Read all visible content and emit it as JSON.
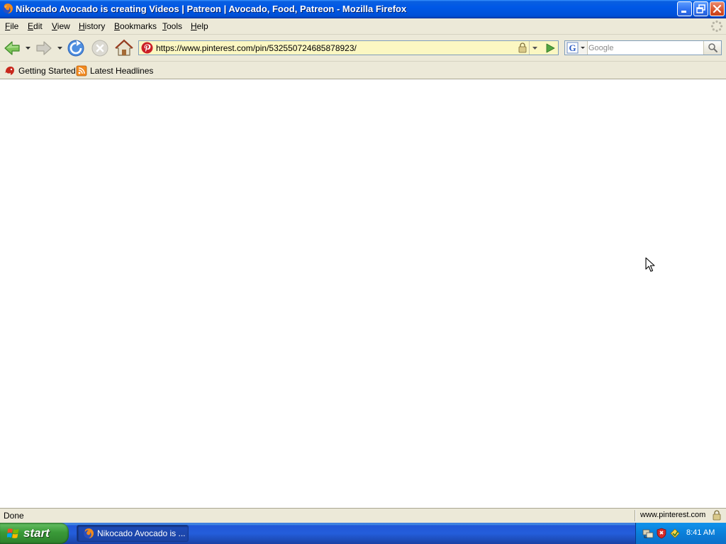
{
  "window": {
    "title": "Nikocado Avocado is creating Videos | Patreon | Avocado, Food, Patreon - Mozilla Firefox",
    "app_icon": "firefox-icon",
    "controls": [
      "minimize-icon",
      "restore-icon",
      "close-icon"
    ]
  },
  "menubar": {
    "items": [
      {
        "label": "File",
        "access": "F",
        "rest": "ile"
      },
      {
        "label": "Edit",
        "access": "E",
        "rest": "dit"
      },
      {
        "label": "View",
        "access": "V",
        "rest": "iew"
      },
      {
        "label": "History",
        "access": "H",
        "rest": "istory"
      },
      {
        "label": "Bookmarks",
        "access": "B",
        "rest": "ookmarks"
      },
      {
        "label": "Tools",
        "access": "T",
        "rest": "ools"
      },
      {
        "label": "Help",
        "access": "H",
        "rest": "elp"
      }
    ]
  },
  "navbar": {
    "buttons": [
      "back-icon",
      "forward-icon",
      "reload-icon",
      "stop-icon",
      "home-icon"
    ],
    "url": "https://www.pinterest.com/pin/532550724685878923/",
    "site_icon": "pinterest-icon",
    "search": {
      "engine_icon": "google-icon",
      "placeholder": "Google",
      "value": ""
    }
  },
  "bookmarks": {
    "items": [
      {
        "label": "Getting Started",
        "icon": "firefox-bookmark-icon"
      },
      {
        "label": "Latest Headlines",
        "icon": "rss-icon"
      }
    ]
  },
  "statusbar": {
    "text": "Done",
    "domain": "www.pinterest.com"
  },
  "taskbar": {
    "start_label": "start",
    "task_label": "Nikocado Avocado is ...",
    "clock": "8:41 AM",
    "tray_icons": [
      "network-icon",
      "security-shield-icon",
      "update-icon"
    ]
  },
  "colors": {
    "titlebar": "#0058e6",
    "chrome": "#ece9d8",
    "urlbar_bg": "#fbf7c2",
    "start_green": "#3a9a38",
    "taskbar_blue": "#245edb"
  }
}
